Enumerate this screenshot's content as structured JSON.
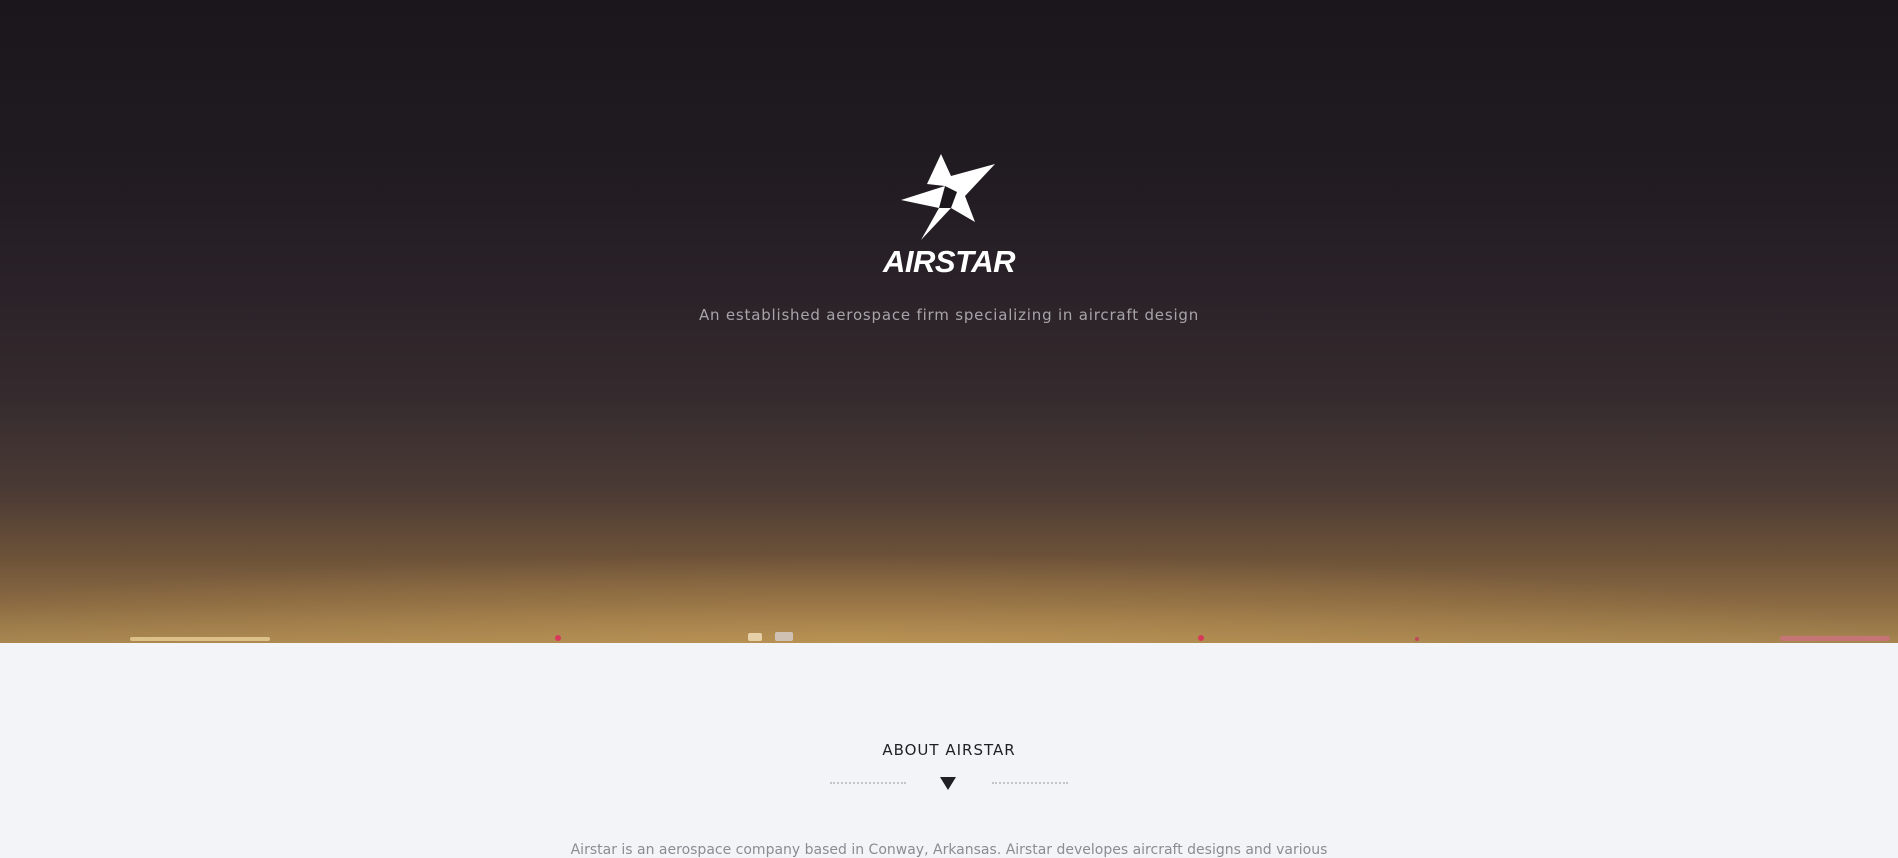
{
  "brand": {
    "name": "AIRSTAR",
    "logo_icon": "airstar-star-icon",
    "tagline": "An established aerospace firm specializing in aircraft design"
  },
  "about": {
    "heading": "ABOUT AIRSTAR",
    "divider_icon": "chevron-down-triangle-icon",
    "text": "Airstar is an aerospace company based in Conway, Arkansas. Airstar developes aircraft designs and various"
  },
  "colors": {
    "hero_top": "#1a161b",
    "hero_bottom": "#a68550",
    "section_bg": "#f3f4f8",
    "heading": "#1f1f24",
    "tagline": "#a7a4a8",
    "body_text": "#8a8c94"
  }
}
